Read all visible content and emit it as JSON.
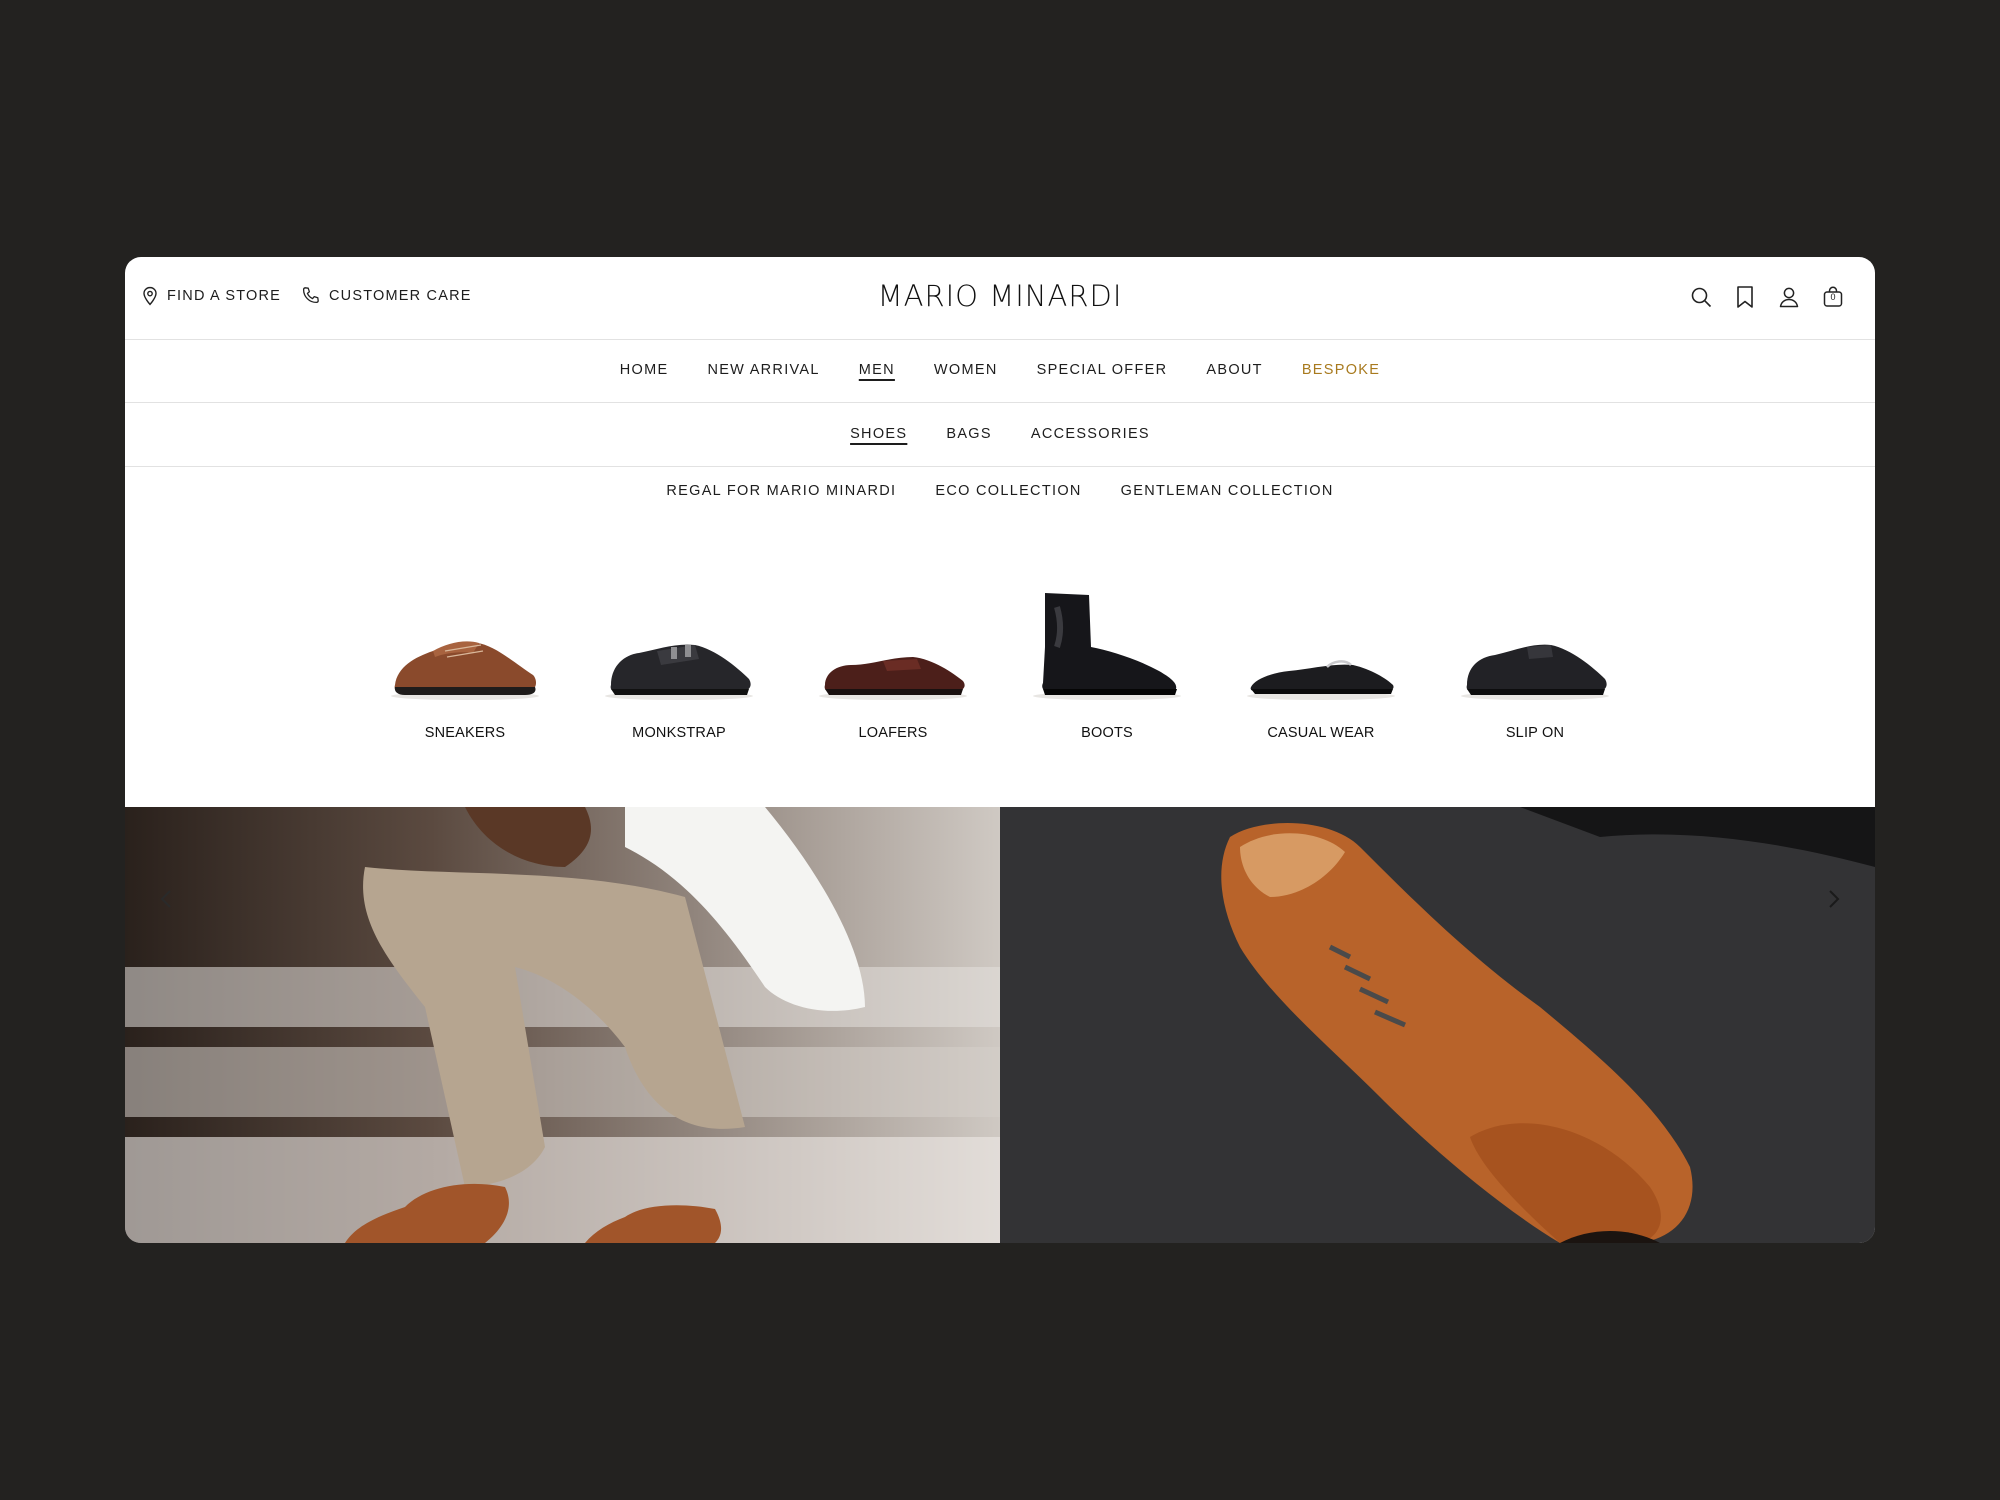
{
  "brand": {
    "logo": "MARIO MINARDI"
  },
  "utility": {
    "find_store": "FIND A STORE",
    "customer_care": "CUSTOMER CARE"
  },
  "header_icons": [
    "search-icon",
    "bookmark-icon",
    "user-icon",
    "bag-icon"
  ],
  "cart": {
    "count": "0"
  },
  "nav": {
    "items": [
      {
        "label": "HOME"
      },
      {
        "label": "NEW ARRIVAL"
      },
      {
        "label": "MEN",
        "active": true
      },
      {
        "label": "WOMEN"
      },
      {
        "label": "SPECIAL OFFER"
      },
      {
        "label": "ABOUT"
      },
      {
        "label": "BESPOKE",
        "highlight": true
      }
    ]
  },
  "subnav": {
    "items": [
      {
        "label": "SHOES",
        "active": true
      },
      {
        "label": "BAGS"
      },
      {
        "label": "ACCESSORIES"
      }
    ]
  },
  "collections": {
    "items": [
      {
        "label": "REGAL FOR MARIO MINARDI"
      },
      {
        "label": "ECO COLLECTION"
      },
      {
        "label": "GENTLEMAN COLLECTION"
      }
    ]
  },
  "categories": [
    {
      "label": "SNEAKERS"
    },
    {
      "label": "MONKSTRAP"
    },
    {
      "label": "LOAFERS"
    },
    {
      "label": "BOOTS"
    },
    {
      "label": "CASUAL WEAR"
    },
    {
      "label": "SLIP ON"
    }
  ],
  "colors": {
    "background": "#232220",
    "accent_gold": "#a87a1e",
    "text": "#1d1d1d"
  }
}
